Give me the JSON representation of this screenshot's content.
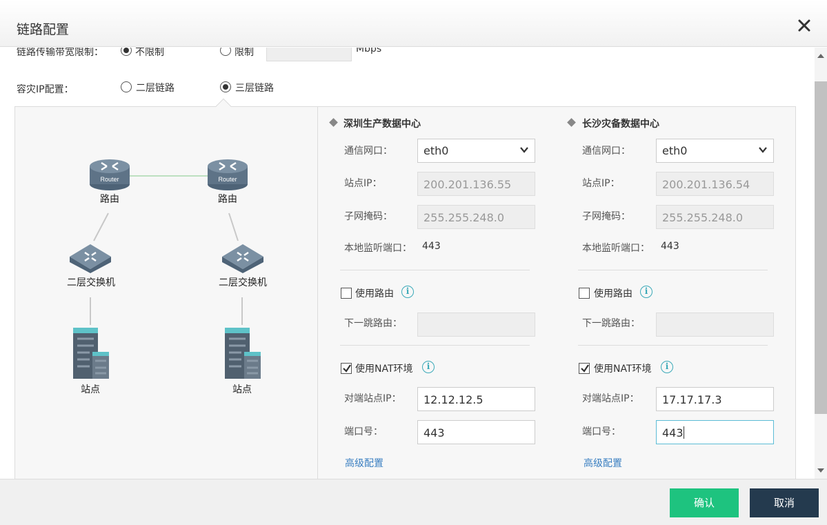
{
  "dialog": {
    "title": "链路配置"
  },
  "bandwidth": {
    "label": "链路传输带宽限制：",
    "option_unlimited": "不限制",
    "option_limit": "限制",
    "unit": "Mbps",
    "selected": "不限制"
  },
  "dr_ip": {
    "label": "容灾IP配置：",
    "option_l2": "二层链路",
    "option_l3": "三层链路",
    "selected": "三层链路"
  },
  "topology": {
    "left": {
      "router": "路由",
      "switch": "二层交换机",
      "site": "站点"
    },
    "right": {
      "router": "路由",
      "switch": "二层交换机",
      "site": "站点"
    },
    "router_badge": "Router"
  },
  "sites": [
    {
      "title": "深圳生产数据中心",
      "iface_label": "通信网口：",
      "iface_value": "eth0",
      "ip_label": "站点IP：",
      "ip_value": "200.201.136.55",
      "mask_label": "子网掩码：",
      "mask_value": "255.255.248.0",
      "port_label": "本地监听端口：",
      "port_value": "443",
      "use_route_label": "使用路由",
      "use_route_checked": false,
      "next_hop_label": "下一跳路由：",
      "next_hop_value": "",
      "use_nat_label": "使用NAT环境",
      "use_nat_checked": true,
      "peer_ip_label": "对端站点IP：",
      "peer_ip_value": "12.12.12.5",
      "peer_port_label": "端口号：",
      "peer_port_value": "443",
      "advanced": "高级配置"
    },
    {
      "title": "长沙灾备数据中心",
      "iface_label": "通信网口：",
      "iface_value": "eth0",
      "ip_label": "站点IP：",
      "ip_value": "200.201.136.54",
      "mask_label": "子网掩码：",
      "mask_value": "255.255.248.0",
      "port_label": "本地监听端口：",
      "port_value": "443",
      "use_route_label": "使用路由",
      "use_route_checked": false,
      "next_hop_label": "下一跳路由：",
      "next_hop_value": "",
      "use_nat_label": "使用NAT环境",
      "use_nat_checked": true,
      "peer_ip_label": "对端站点IP：",
      "peer_ip_value": "17.17.17.3",
      "peer_port_label": "端口号：",
      "peer_port_value": "443",
      "advanced": "高级配置"
    }
  ],
  "footer": {
    "ok": "确认",
    "cancel": "取消"
  },
  "colors": {
    "ok": "#1ec37f",
    "cancel": "#243a4e",
    "link": "#3a7fc1",
    "info": "#3aa9b8"
  }
}
